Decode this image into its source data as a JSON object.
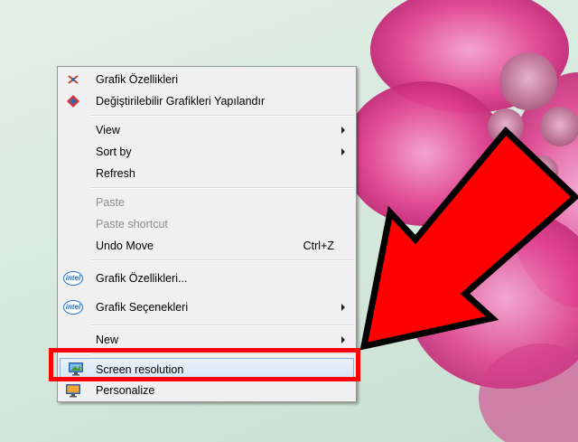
{
  "context_menu": {
    "items": [
      {
        "label": "Grafik Özellikleri",
        "icon": "intel-graphics-icon",
        "disabled": false
      },
      {
        "label": "Değiştirilebilir Grafikleri Yapılandır",
        "icon": "switchable-graphics-icon",
        "disabled": false
      },
      {
        "label": "View",
        "submenu": true
      },
      {
        "label": "Sort by",
        "submenu": true
      },
      {
        "label": "Refresh"
      },
      {
        "label": "Paste",
        "disabled": true
      },
      {
        "label": "Paste shortcut",
        "disabled": true
      },
      {
        "label": "Undo Move",
        "shortcut": "Ctrl+Z"
      },
      {
        "label": "Grafik Özellikleri...",
        "icon": "intel-logo-icon",
        "logo_text": "intel"
      },
      {
        "label": "Grafik Seçenekleri",
        "icon": "intel-logo-icon",
        "logo_text": "intel",
        "submenu": true
      },
      {
        "label": "New",
        "submenu": true
      },
      {
        "label": "Screen resolution",
        "icon": "monitor-icon",
        "highlighted": true
      },
      {
        "label": "Personalize",
        "icon": "personalize-icon"
      }
    ]
  },
  "colors": {
    "annotation": "#ff0000",
    "highlight_border": "#8ab0dd",
    "disabled_text": "#8d8d8d"
  }
}
